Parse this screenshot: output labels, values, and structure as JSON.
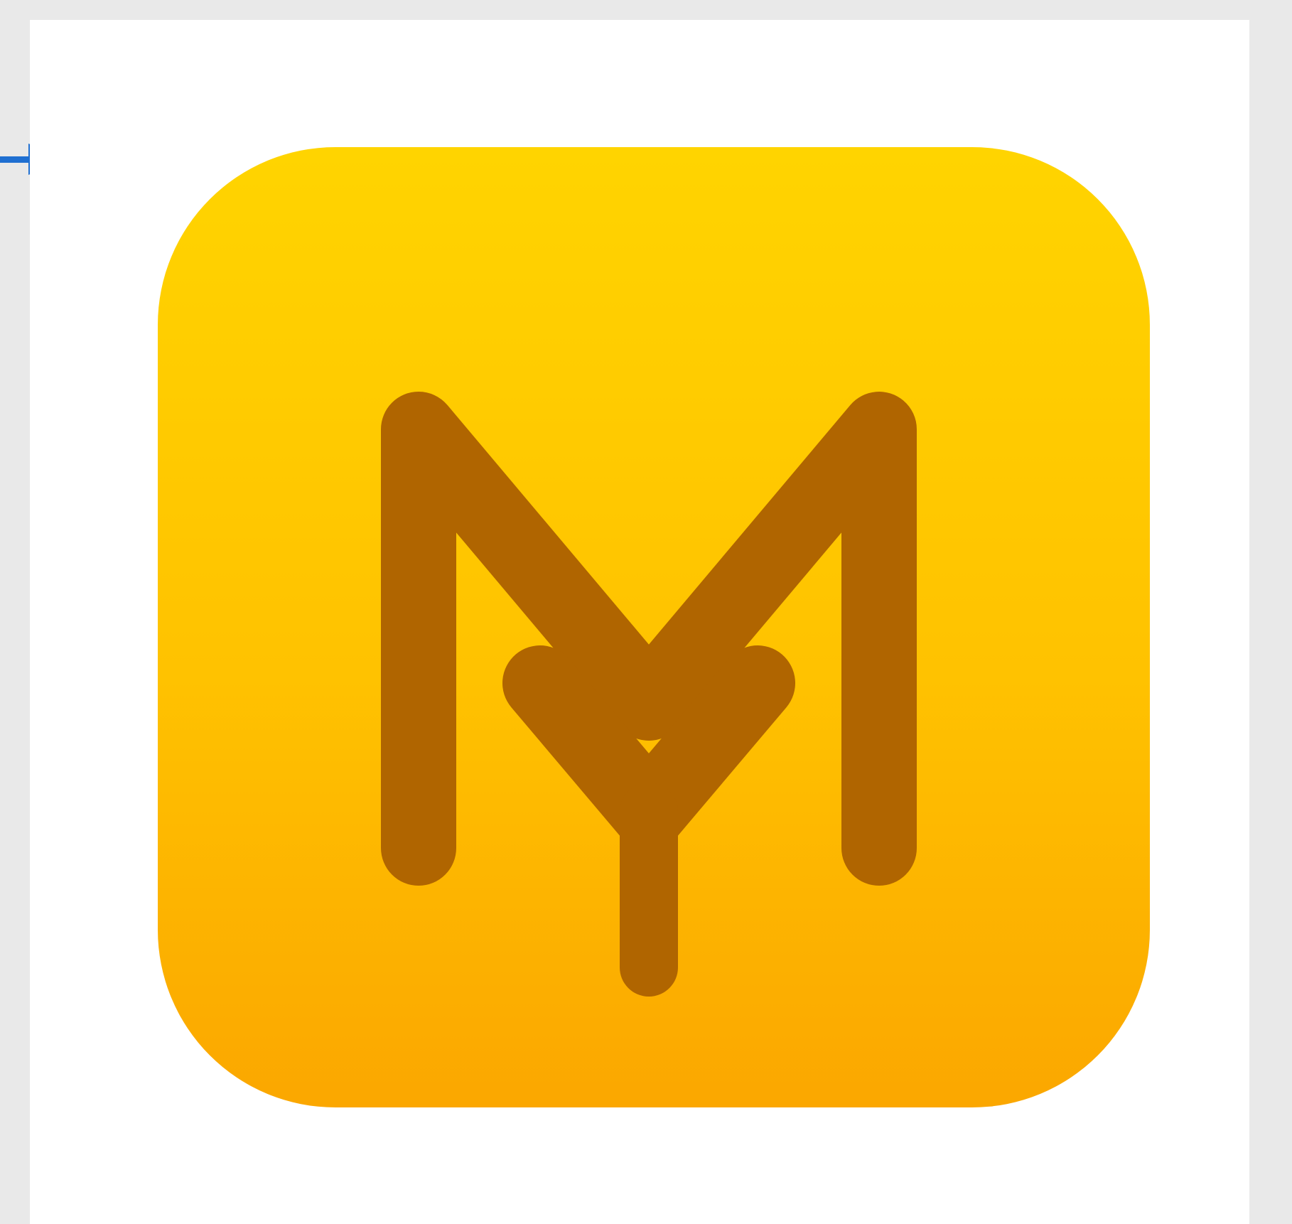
{
  "colors": {
    "window_background": "#e9e9e9",
    "panel_background": "#ffffff",
    "arrow": "#1f6fd1",
    "icon_gradient_top": "#ffd400",
    "icon_gradient_bottom": "#fba700",
    "monogram": "#b06500"
  },
  "icons": {
    "pointer": "arrow-right-icon",
    "logo": "my-monogram-app-icon"
  }
}
